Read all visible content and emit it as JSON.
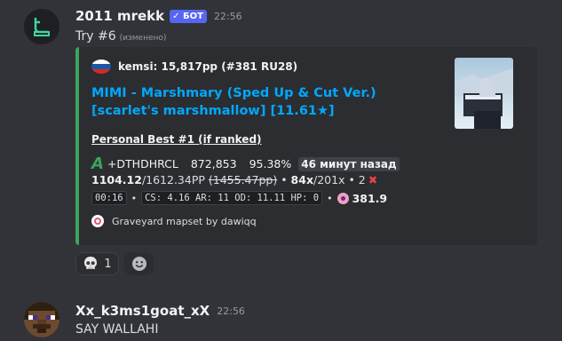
{
  "message1": {
    "username": "2011 mrekk",
    "bot_badge": "✓ БОТ",
    "timestamp": "22:56",
    "content": "Try #6",
    "edited": "(изменено)",
    "embed": {
      "accent_color": "#3ba55d",
      "author": "kemsi: 15,817pp (#381 RU28)",
      "title": "MIMI - Marshmary (Sped Up & Cut Ver.) [scarlet's marshmallow] [11.61★]",
      "section_title": "Personal Best #1 (if ranked)",
      "grade": "A",
      "mods": "+DTHDHRCL",
      "score": "872,853",
      "accuracy": "95.38%",
      "time_ago": "46 минут назад",
      "pp": "1104.12",
      "pp_rest": "/1612.34PP ",
      "pp_fc": "(1455.47pp)",
      "combo_sep": " • ",
      "combo": "84x",
      "max_combo": "/201x",
      "misses": " • 2",
      "miss_icon": "✖",
      "length": "00:16",
      "difficulty": "CS: 4.16 AR: 11 OD: 11.11 HP: 0",
      "star_rating": "381.9",
      "footer": "Graveyard mapset by dawiqq"
    },
    "reactions": [
      {
        "emoji": "skull-icon",
        "count": "1"
      },
      {
        "emoji": "add-reaction-icon",
        "count": ""
      }
    ]
  },
  "message2": {
    "username": "Xx_k3ms1goat_xX",
    "timestamp": "22:56",
    "content": "SAY WALLAHI"
  }
}
